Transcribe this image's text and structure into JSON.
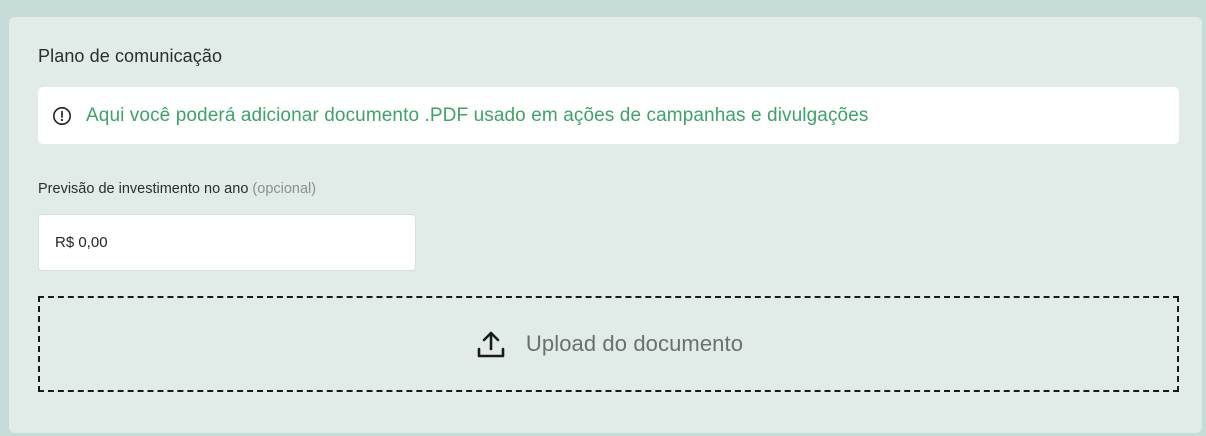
{
  "section": {
    "title": "Plano de comunicação"
  },
  "info": {
    "icon": "info-circle-icon",
    "text": "Aqui você poderá adicionar documento .PDF usado em ações de campanhas e divulgações",
    "color": "#3fa26a"
  },
  "investment": {
    "label": "Previsão de investimento no ano",
    "optional_label": "(opcional)",
    "value": "R$ 0,00"
  },
  "upload": {
    "icon": "upload-icon",
    "label": "Upload do documento"
  }
}
